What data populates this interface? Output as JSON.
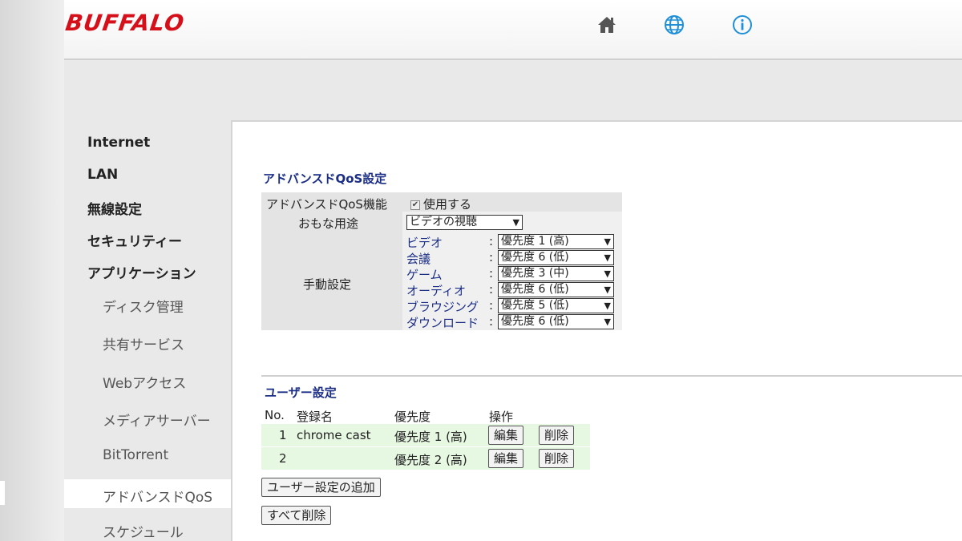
{
  "header": {
    "logo": "BUFFALO",
    "icons": [
      "home-icon",
      "globe-icon",
      "info-icon"
    ]
  },
  "sidebar": {
    "top_items": [
      "Internet",
      "LAN",
      "無線設定",
      "セキュリティー",
      "アプリケーション"
    ],
    "sub_items": [
      "ディスク管理",
      "共有サービス",
      "Webアクセス",
      "メディアサーバー",
      "BitTorrent",
      "アドバンスドQoS",
      "スケジュール"
    ],
    "active": "アドバンスドQoS"
  },
  "advanced_qos": {
    "title": "アドバンスドQoS設定",
    "feature_label": "アドバンスドQoS機能",
    "feature_checkbox_label": "使用する",
    "feature_enabled": true,
    "main_use_label": "おもな用途",
    "main_use_value": "ビデオの視聴",
    "manual_label": "手動設定",
    "manual_rows": [
      {
        "name": "ビデオ",
        "value": "優先度 1 (高)"
      },
      {
        "name": "会議",
        "value": "優先度 6 (低)"
      },
      {
        "name": "ゲーム",
        "value": "優先度 3 (中)"
      },
      {
        "name": "オーディオ",
        "value": "優先度 6 (低)"
      },
      {
        "name": "ブラウジング",
        "value": "優先度 5 (低)"
      },
      {
        "name": "ダウンロード",
        "value": "優先度 6 (低)"
      }
    ],
    "colon": ":"
  },
  "user_settings": {
    "title": "ユーザー設定",
    "columns": [
      "No.",
      "登録名",
      "優先度",
      "操作"
    ],
    "rows": [
      {
        "no": "1",
        "name": "chrome cast",
        "priority": "優先度 1 (高)",
        "edit": "編集",
        "delete": "削除"
      },
      {
        "no": "2",
        "name": "",
        "priority": "優先度 2 (高)",
        "edit": "編集",
        "delete": "削除"
      }
    ],
    "add_button": "ユーザー設定の追加",
    "delete_all_button": "すべて削除"
  },
  "colors": {
    "brand": "#d6101a",
    "section_title": "#1b2e86",
    "icon": "#1f8fd8",
    "row_bg": "#e6f7e2"
  }
}
